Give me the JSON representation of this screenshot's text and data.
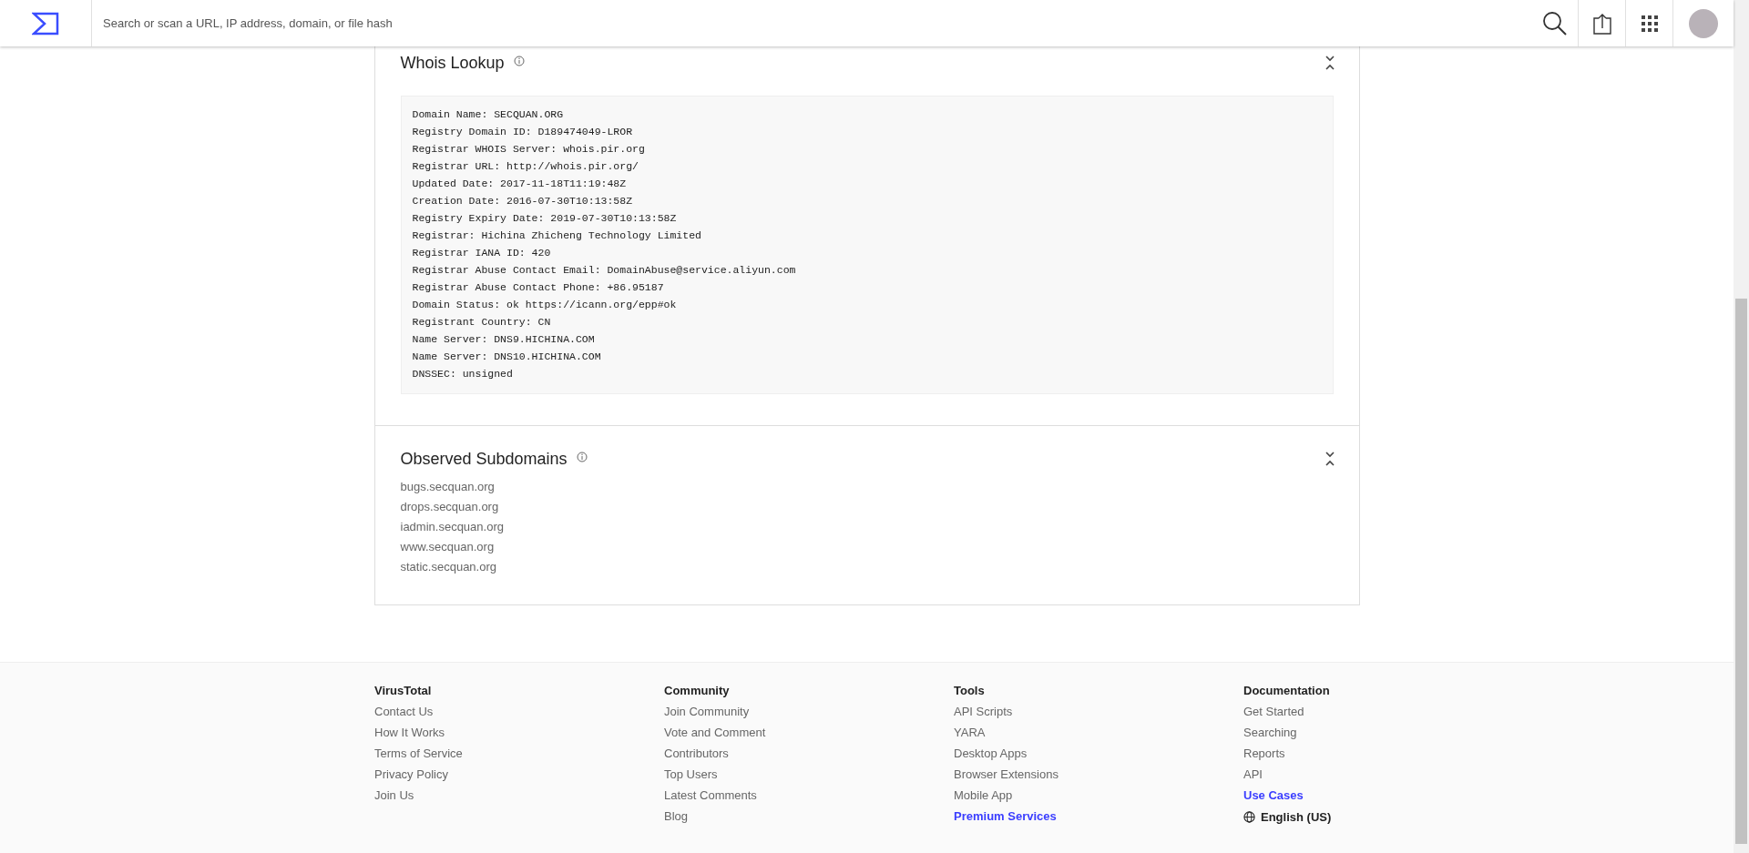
{
  "header": {
    "search": {
      "placeholder": "Search or scan a URL, IP address, domain, or file hash"
    }
  },
  "whois": {
    "title": "Whois Lookup",
    "lines": [
      "Domain Name: SECQUAN.ORG",
      "Registry Domain ID: D189474049-LROR",
      "Registrar WHOIS Server: whois.pir.org",
      "Registrar URL: http://whois.pir.org/",
      "Updated Date: 2017-11-18T11:19:48Z",
      "Creation Date: 2016-07-30T10:13:58Z",
      "Registry Expiry Date: 2019-07-30T10:13:58Z",
      "Registrar: Hichina Zhicheng Technology Limited",
      "Registrar IANA ID: 420",
      "Registrar Abuse Contact Email: DomainAbuse@service.aliyun.com",
      "Registrar Abuse Contact Phone: +86.95187",
      "Domain Status: ok https://icann.org/epp#ok",
      "Registrant Country: CN",
      "Name Server: DNS9.HICHINA.COM",
      "Name Server: DNS10.HICHINA.COM",
      "DNSSEC: unsigned"
    ]
  },
  "subdomains": {
    "title": "Observed Subdomains",
    "items": [
      "bugs.secquan.org",
      "drops.secquan.org",
      "iadmin.secquan.org",
      "www.secquan.org",
      "static.secquan.org"
    ]
  },
  "footer": {
    "columns": [
      {
        "heading": "VirusTotal",
        "links": [
          {
            "label": "Contact Us",
            "highlighted": false
          },
          {
            "label": "How It Works",
            "highlighted": false
          },
          {
            "label": "Terms of Service",
            "highlighted": false
          },
          {
            "label": "Privacy Policy",
            "highlighted": false
          },
          {
            "label": "Join Us",
            "highlighted": false
          }
        ]
      },
      {
        "heading": "Community",
        "links": [
          {
            "label": "Join Community",
            "highlighted": false
          },
          {
            "label": "Vote and Comment",
            "highlighted": false
          },
          {
            "label": "Contributors",
            "highlighted": false
          },
          {
            "label": "Top Users",
            "highlighted": false
          },
          {
            "label": "Latest Comments",
            "highlighted": false
          },
          {
            "label": "Blog",
            "highlighted": false
          }
        ]
      },
      {
        "heading": "Tools",
        "links": [
          {
            "label": "API Scripts",
            "highlighted": false
          },
          {
            "label": "YARA",
            "highlighted": false
          },
          {
            "label": "Desktop Apps",
            "highlighted": false
          },
          {
            "label": "Browser Extensions",
            "highlighted": false
          },
          {
            "label": "Mobile App",
            "highlighted": false
          },
          {
            "label": "Premium Services",
            "highlighted": true
          }
        ]
      },
      {
        "heading": "Documentation",
        "links": [
          {
            "label": "Get Started",
            "highlighted": false
          },
          {
            "label": "Searching",
            "highlighted": false
          },
          {
            "label": "Reports",
            "highlighted": false
          },
          {
            "label": "API",
            "highlighted": false
          },
          {
            "label": "Use Cases",
            "highlighted": true
          }
        ]
      }
    ],
    "language": "English (US)"
  }
}
